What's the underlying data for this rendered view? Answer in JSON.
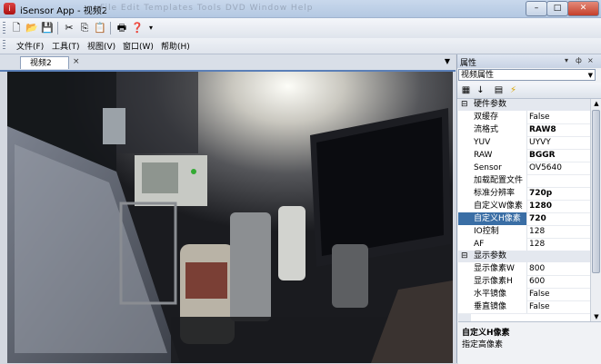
{
  "window": {
    "title": "iSensor App - 视频2",
    "app_icon_glyph": "i",
    "minimize": "–",
    "maximize": "□",
    "close": "✕",
    "ghost_menu": "File  Edit  Templates  Tools  DVD  Window  Help"
  },
  "toolbar": {
    "icons": [
      "new-file-icon",
      "open-folder-icon",
      "save-icon",
      "cut-icon",
      "copy-icon",
      "paste-icon",
      "print-icon",
      "help-icon"
    ],
    "glyphs": [
      "🗋",
      "📂",
      "💾",
      "✂",
      "⎘",
      "📋",
      "🖶",
      "❓"
    ],
    "overflow": "▾"
  },
  "menu": {
    "items": [
      "文件(F)",
      "工具(T)",
      "视图(V)",
      "窗口(W)",
      "帮助(H)"
    ]
  },
  "document": {
    "tab_label": "视频2",
    "tab_close": "×",
    "dropdown": "▼"
  },
  "properties_panel": {
    "title": "属性",
    "pin": "▾",
    "dock": "ф",
    "close": "×",
    "object_selector": "视频属性",
    "tool_glyphs": [
      "▦",
      "↓",
      "▤",
      "⚡"
    ],
    "categories": [
      {
        "toggle": "⊟",
        "label": "硬件参数"
      },
      {
        "toggle": "⊟",
        "label": "显示参数"
      }
    ],
    "hardware_rows": [
      {
        "key": "双缓存",
        "value": "False",
        "bold": false
      },
      {
        "key": "流格式",
        "value": "RAW8",
        "bold": true
      },
      {
        "key": "YUV",
        "value": "UYVY",
        "bold": false
      },
      {
        "key": "RAW",
        "value": "BGGR",
        "bold": true
      },
      {
        "key": "Sensor",
        "value": "OV5640",
        "bold": false
      },
      {
        "key": "加载配置文件",
        "value": "",
        "bold": false
      },
      {
        "key": "标准分辨率",
        "value": "720p",
        "bold": true
      },
      {
        "key": "自定义W像素",
        "value": "1280",
        "bold": true
      },
      {
        "key": "自定义H像素",
        "value": "720",
        "bold": true
      },
      {
        "key": "IO控制",
        "value": "128",
        "bold": false
      },
      {
        "key": "AF",
        "value": "128",
        "bold": false
      }
    ],
    "display_rows": [
      {
        "key": "显示像素W",
        "value": "800",
        "bold": false
      },
      {
        "key": "显示像素H",
        "value": "600",
        "bold": false
      },
      {
        "key": "水平镜像",
        "value": "False",
        "bold": false
      },
      {
        "key": "垂直镜像",
        "value": "False",
        "bold": false
      }
    ],
    "selected_key": "自定义H像素",
    "description_title": "自定义H像素",
    "description_text": "指定高像素"
  },
  "colors": {
    "selection": "#3a6ea5",
    "tab_accent": "#5a7fb8",
    "title_bar": "#b3c8e2"
  }
}
